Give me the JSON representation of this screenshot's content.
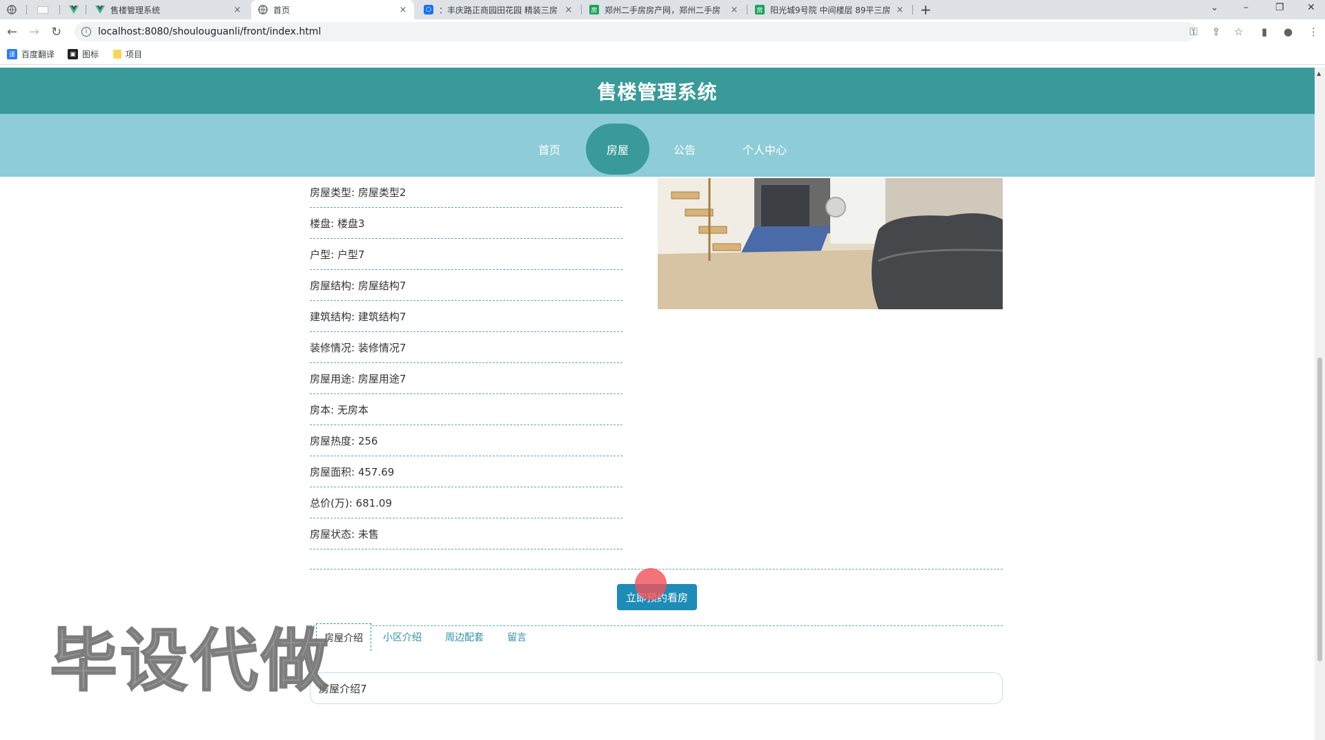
{
  "browser": {
    "tabs": [
      {
        "title": "",
        "icon": "globe-icon"
      },
      {
        "title": "",
        "icon": "blank-page-icon"
      },
      {
        "title": "",
        "icon": "vue-logo-icon"
      },
      {
        "title": "售楼管理系统",
        "icon": "vue-logo-icon"
      },
      {
        "title": "首页",
        "icon": "globe-icon"
      },
      {
        "title": "：丰庆路正商园田花园 精装三房",
        "icon": "app-icon"
      },
      {
        "title": "郑州二手房房产网，郑州二手房",
        "icon": "fang-logo-icon"
      },
      {
        "title": "阳光城9号院 中间楼层 89平三房",
        "icon": "fang-logo-icon"
      }
    ],
    "close_glyph": "×",
    "new_tab_glyph": "+",
    "url": "localhost:8080/shoulouguanli/front/index.html",
    "bookmarks": [
      {
        "label": "百度翻译",
        "icon": "baidu-translate-icon"
      },
      {
        "label": "图标",
        "icon": "image-icon"
      },
      {
        "label": "项目",
        "icon": "folder-icon"
      }
    ]
  },
  "header": {
    "title": "售楼管理系统"
  },
  "nav": {
    "items": [
      {
        "label": "首页",
        "active": false
      },
      {
        "label": "房屋",
        "active": true
      },
      {
        "label": "公告",
        "active": false
      },
      {
        "label": "个人中心",
        "active": false
      }
    ]
  },
  "details": {
    "fields": [
      "房屋类型: 房屋类型2",
      "楼盘: 楼盘3",
      "户型: 户型7",
      "房屋结构: 房屋结构7",
      "建筑结构: 建筑结构7",
      "装修情况: 装修情况7",
      "房屋用途: 房屋用途7",
      "房本: 无房本",
      "房屋热度: 256",
      "房屋面积: 457.69",
      "总价(万): 681.09",
      "房屋状态: 未售"
    ],
    "book_button": "立即预约看房"
  },
  "detail_tabs": {
    "items": [
      "房屋介绍",
      "小区介绍",
      "周边配套",
      "留言"
    ],
    "active_content": "房屋介绍7"
  },
  "watermark": "毕设代做",
  "colors": {
    "header_bg": "#3a9a9a",
    "nav_bg": "#8ecdd8",
    "button_bg": "#1e8cb6"
  }
}
